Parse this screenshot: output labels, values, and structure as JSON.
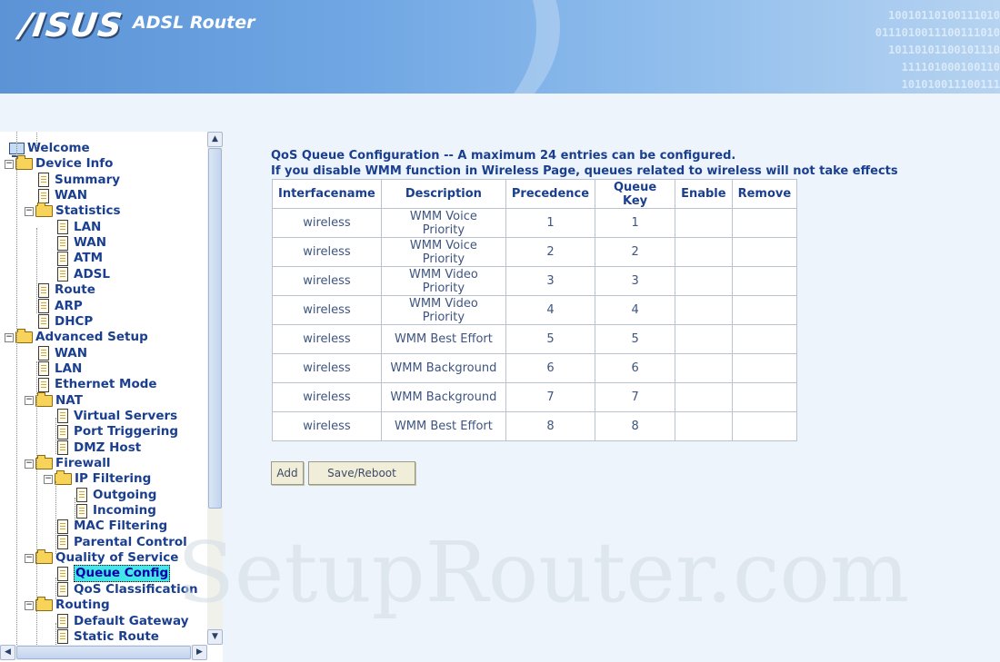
{
  "header": {
    "logo": "/ISUS",
    "product": "ADSL Router",
    "binary_lines": [
      "10010110100111010",
      "0111010011100111010",
      "10110101100101110",
      "111101000100110",
      "101010011100111"
    ]
  },
  "nav": {
    "items": [
      {
        "label": "Welcome",
        "icon": "computer-icon"
      },
      {
        "label": "Device Info",
        "icon": "folder-icon"
      },
      {
        "label": "Summary",
        "icon": "page-icon"
      },
      {
        "label": "WAN",
        "icon": "page-icon"
      },
      {
        "label": "Statistics",
        "icon": "folder-icon"
      },
      {
        "label": "LAN",
        "icon": "page-icon"
      },
      {
        "label": "WAN",
        "icon": "page-icon"
      },
      {
        "label": "ATM",
        "icon": "page-icon"
      },
      {
        "label": "ADSL",
        "icon": "page-icon"
      },
      {
        "label": "Route",
        "icon": "page-icon"
      },
      {
        "label": "ARP",
        "icon": "page-icon"
      },
      {
        "label": "DHCP",
        "icon": "page-icon"
      },
      {
        "label": "Advanced Setup",
        "icon": "folder-icon"
      },
      {
        "label": "WAN",
        "icon": "page-icon"
      },
      {
        "label": "LAN",
        "icon": "page-icon"
      },
      {
        "label": "Ethernet Mode",
        "icon": "page-icon"
      },
      {
        "label": "NAT",
        "icon": "folder-icon"
      },
      {
        "label": "Virtual Servers",
        "icon": "page-icon"
      },
      {
        "label": "Port Triggering",
        "icon": "page-icon"
      },
      {
        "label": "DMZ Host",
        "icon": "page-icon"
      },
      {
        "label": "Firewall",
        "icon": "folder-icon"
      },
      {
        "label": "IP Filtering",
        "icon": "folder-icon"
      },
      {
        "label": "Outgoing",
        "icon": "page-icon"
      },
      {
        "label": "Incoming",
        "icon": "page-icon"
      },
      {
        "label": "MAC Filtering",
        "icon": "page-icon"
      },
      {
        "label": "Parental Control",
        "icon": "page-icon"
      },
      {
        "label": "Quality of Service",
        "icon": "folder-icon"
      },
      {
        "label": "Queue Config",
        "icon": "page-icon",
        "selected": true
      },
      {
        "label": "QoS Classification",
        "icon": "page-icon"
      },
      {
        "label": "Routing",
        "icon": "folder-icon"
      },
      {
        "label": "Default Gateway",
        "icon": "page-icon"
      },
      {
        "label": "Static Route",
        "icon": "page-icon"
      }
    ]
  },
  "main": {
    "heading_line1": "QoS Queue Configuration -- A maximum 24 entries can be configured.",
    "heading_line2": "If you disable WMM function in Wireless Page, queues related to wireless will not take effects",
    "table": {
      "columns": [
        "Interfacename",
        "Description",
        "Precedence",
        "Queue Key",
        "Enable",
        "Remove"
      ],
      "rows": [
        [
          "wireless",
          "WMM Voice Priority",
          "1",
          "1",
          "",
          ""
        ],
        [
          "wireless",
          "WMM Voice Priority",
          "2",
          "2",
          "",
          ""
        ],
        [
          "wireless",
          "WMM Video Priority",
          "3",
          "3",
          "",
          ""
        ],
        [
          "wireless",
          "WMM Video Priority",
          "4",
          "4",
          "",
          ""
        ],
        [
          "wireless",
          "WMM Best Effort",
          "5",
          "5",
          "",
          ""
        ],
        [
          "wireless",
          "WMM Background",
          "6",
          "6",
          "",
          ""
        ],
        [
          "wireless",
          "WMM Background",
          "7",
          "7",
          "",
          ""
        ],
        [
          "wireless",
          "WMM Best Effort",
          "8",
          "8",
          "",
          ""
        ]
      ]
    },
    "add_label": "Add",
    "save_label": "Save/Reboot"
  },
  "watermark": "SetupRouter.com",
  "colors": {
    "accent_text": "#1b3f8f",
    "banner": "#6fa6e3",
    "selected_highlight": "#44e7e7"
  }
}
